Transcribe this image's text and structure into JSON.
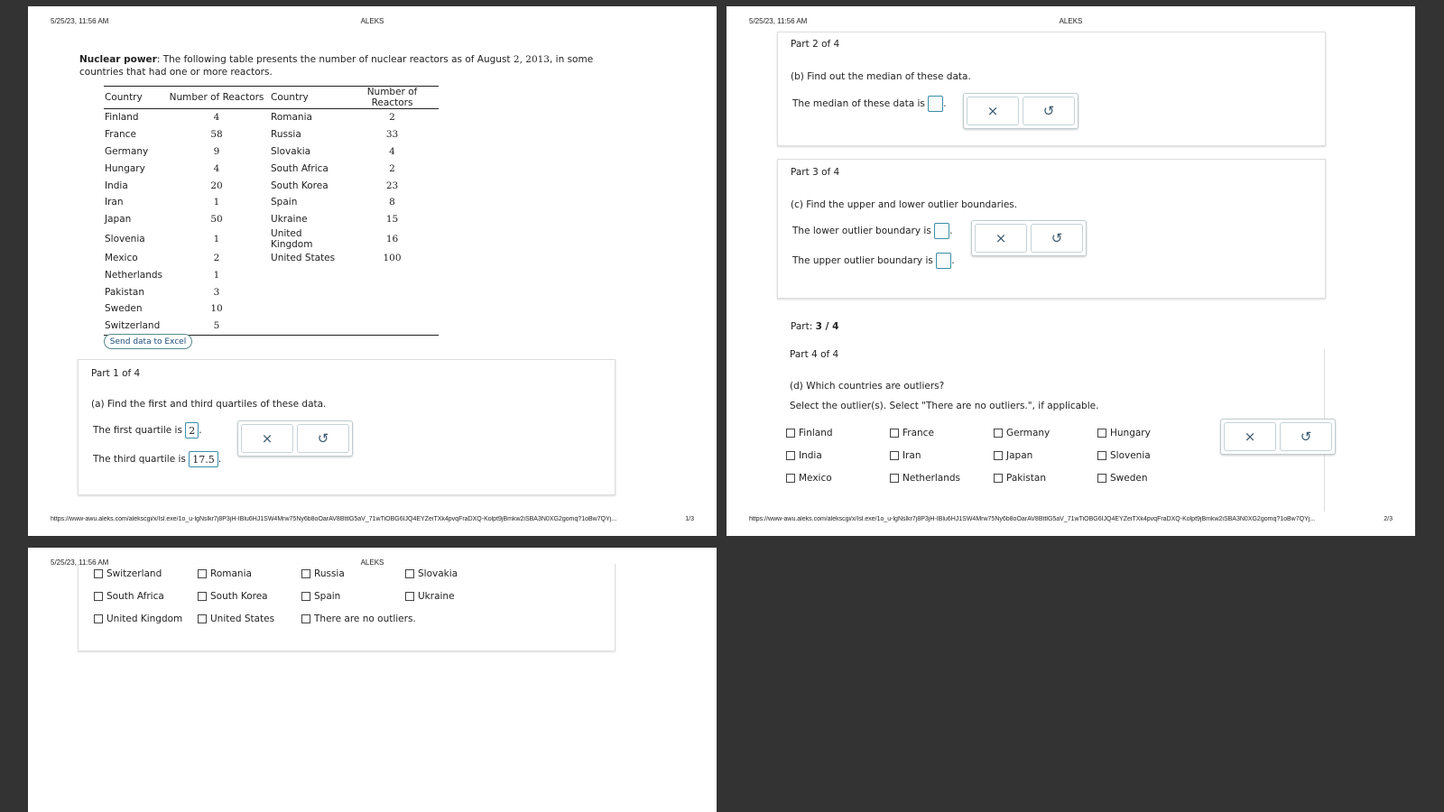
{
  "header": {
    "date": "5/25/23, 11:56 AM",
    "title": "ALEKS"
  },
  "footer": {
    "url": "https://www-awu.aleks.com/alekscgi/x/Isl.exe/1o_u-lgNslkr7j8P3jH-IBlu6HJ1SW4Mrw75Ny6b8oOarAV8BttlG5aV_71wTiOBG6IJQ4EYZeiTXk4pvqFraDXQ-Kolpt9jBmkw2iSBA3N0XG2gomq?1oBw7QYj...",
    "page1": "1/3",
    "page2": "2/3"
  },
  "intro": {
    "bold": "Nuclear power",
    "text": ": The following table presents the number of nuclear reactors as of August ",
    "date": "2, 2013",
    "text2": ", in some countries that had one or more reactors."
  },
  "table": {
    "headers": [
      "Country",
      "Number of Reactors",
      "Country",
      "Number of Reactors"
    ],
    "rows": [
      [
        "Finland",
        "4",
        "Romania",
        "2"
      ],
      [
        "France",
        "58",
        "Russia",
        "33"
      ],
      [
        "Germany",
        "9",
        "Slovakia",
        "4"
      ],
      [
        "Hungary",
        "4",
        "South Africa",
        "2"
      ],
      [
        "India",
        "20",
        "South Korea",
        "23"
      ],
      [
        "Iran",
        "1",
        "Spain",
        "8"
      ],
      [
        "Japan",
        "50",
        "Ukraine",
        "15"
      ],
      [
        "Slovenia",
        "1",
        "United Kingdom",
        "16"
      ],
      [
        "Mexico",
        "2",
        "United States",
        "100"
      ],
      [
        "Netherlands",
        "1",
        "",
        ""
      ],
      [
        "Pakistan",
        "3",
        "",
        ""
      ],
      [
        "Sweden",
        "10",
        "",
        ""
      ],
      [
        "Switzerland",
        "5",
        "",
        ""
      ]
    ]
  },
  "excel_button": "Send data to Excel",
  "part1": {
    "title": "Part 1 of 4",
    "question": "(a) Find the first and third quartiles of these data.",
    "q1_label": "The first quartile is",
    "q1_value": "2",
    "q3_label": "The third quartile is",
    "q3_value": "17.5"
  },
  "part2": {
    "title": "Part 2 of 4",
    "question": "(b) Find out the median of these data.",
    "median_label": "The median of these data is",
    "median_value": ""
  },
  "part3": {
    "title": "Part 3 of 4",
    "question": "(c) Find the upper and lower outlier boundaries.",
    "lower_label": "The lower outlier boundary is",
    "upper_label": "The upper outlier boundary is"
  },
  "progress": {
    "label": "Part:",
    "value": "3 / 4"
  },
  "part4": {
    "title": "Part 4 of 4",
    "question": "(d) Which countries are outliers?",
    "instruction": "Select the outlier(s). Select \"There are no outliers.\", if applicable.",
    "options_page2": [
      "Finland",
      "France",
      "Germany",
      "Hungary",
      "India",
      "Iran",
      "Japan",
      "Slovenia",
      "Mexico",
      "Netherlands",
      "Pakistan",
      "Sweden"
    ],
    "options_page3": [
      "Switzerland",
      "Romania",
      "Russia",
      "Slovakia",
      "South Africa",
      "South Korea",
      "Spain",
      "Ukraine",
      "United Kingdom",
      "United States",
      "There are no outliers."
    ]
  },
  "tools": {
    "clear": "×",
    "undo": "↺"
  }
}
